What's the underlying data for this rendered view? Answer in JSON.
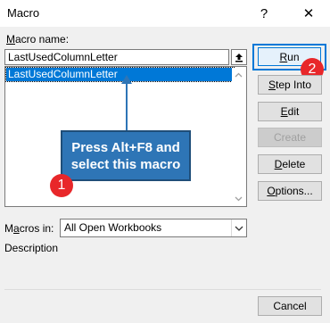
{
  "window": {
    "title": "Macro",
    "help_glyph": "?",
    "close_glyph": "✕"
  },
  "macro_name": {
    "label_prefix": "M",
    "label_rest": "acro name:",
    "value": "LastUsedColumnLetter"
  },
  "macro_list": {
    "items": [
      "LastUsedColumnLetter"
    ]
  },
  "buttons": {
    "run": {
      "u": "R",
      "rest": "un"
    },
    "step_into": {
      "u": "S",
      "rest": "tep Into"
    },
    "edit": {
      "u": "E",
      "rest": "dit"
    },
    "create": "Create",
    "delete": {
      "u": "D",
      "rest": "elete"
    },
    "options": {
      "u": "O",
      "rest": "ptions..."
    },
    "cancel": "Cancel"
  },
  "macros_in": {
    "label_pre": "M",
    "label_u": "a",
    "label_post": "cros in:",
    "value": "All Open Workbooks"
  },
  "description": {
    "label": "Description"
  },
  "annotation": {
    "callout_line1": "Press Alt+F8 and",
    "callout_line2": "select this macro",
    "badge1": "1",
    "badge2": "2",
    "accent": "#2e75b6",
    "badge_color": "#e8272a"
  }
}
